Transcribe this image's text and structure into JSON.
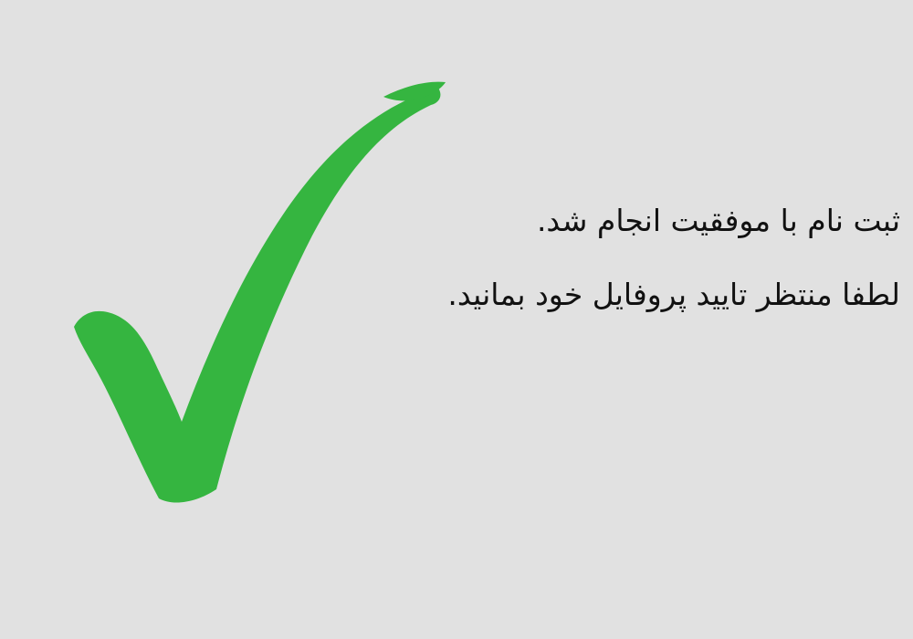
{
  "colors": {
    "background": "#e1e1e1",
    "check": "#35b540",
    "text": "#111111"
  },
  "icon": {
    "name": "checkmark-icon"
  },
  "message": {
    "line1": "ثبت نام با موفقیت انجام شد.",
    "line2": "لطفا منتظر تایید پروفایل خود بمانید."
  }
}
